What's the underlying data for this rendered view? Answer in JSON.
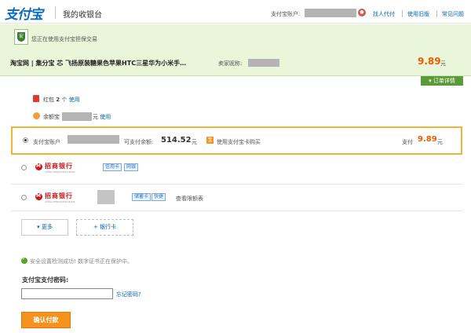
{
  "header": {
    "logo": "支付宝",
    "title": "我的收银台",
    "account_label": "支付宝账户:",
    "nav": [
      "找人代付",
      "使用旧版",
      "常见问题"
    ]
  },
  "banner": {
    "notice": "您正在使用支付宝担保交易",
    "order_title": "淘宝网 | 集分宝 芯 飞扬原装糖果色苹果HTC三星华为小米手…",
    "seller_label": "卖家昵称:",
    "amount": "9.89",
    "amount_unit": "元",
    "order_detail": "订单详情"
  },
  "redpacket": {
    "label": "红包",
    "count": "2",
    "unit": "个",
    "use": "使用"
  },
  "balance": {
    "label": "余额宝",
    "unit": "元",
    "use": "使用"
  },
  "selected_channel": {
    "label": "支付宝账户",
    "balance_label": "可支付余额:",
    "balance": "514.52",
    "balance_unit": "元",
    "bao_icon": "宝",
    "pay_password_link": "使用支付宝卡购买",
    "pay_label": "支付",
    "pay_amount": "9.89",
    "pay_unit": "元"
  },
  "banks": [
    {
      "name": "招商银行",
      "sub": "CHINA MERCHANTS BANK",
      "tags": [
        "信用卡",
        "网银"
      ]
    },
    {
      "name": "招商银行",
      "sub": "CHINA MERCHANTS BANK",
      "tags": [
        "储蓄卡",
        "快捷"
      ],
      "link": "查看限额表"
    }
  ],
  "actions": {
    "more": "更多",
    "add_card": "银行卡"
  },
  "security": {
    "text": "安全设置检测成功! 数字证书正在保护中。"
  },
  "password": {
    "label": "支付宝支付密码:",
    "value": "",
    "forgot": "忘记密码?"
  },
  "confirm": "确认付款",
  "colors": {
    "accent_orange": "#f05a00",
    "brand_blue": "#0a6bc1",
    "banner_green": "#e9f6d9",
    "bank_red": "#c8161d"
  }
}
